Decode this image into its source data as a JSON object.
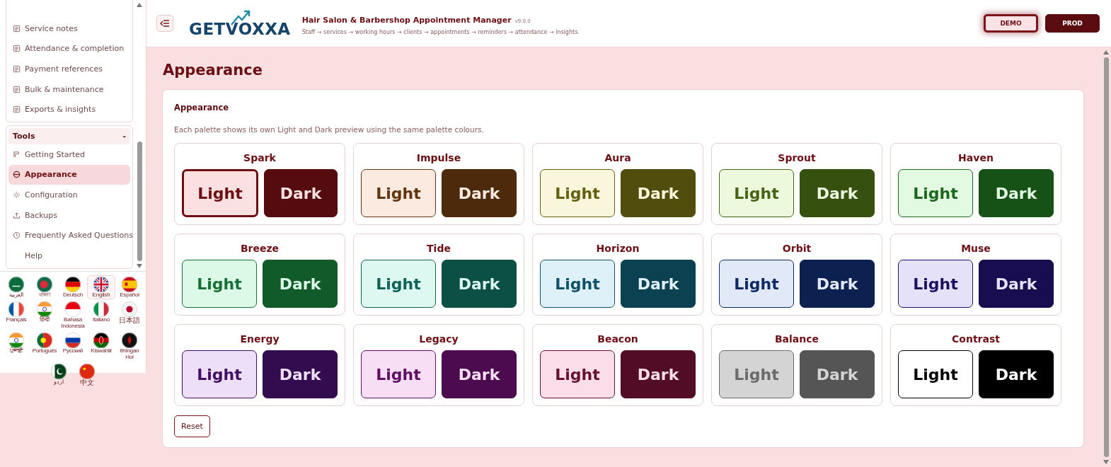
{
  "sidebar": {
    "sections": [
      {
        "items": [
          {
            "label": "Service notes",
            "selected": false
          },
          {
            "label": "Attendance & completion",
            "selected": false
          },
          {
            "label": "Payment references",
            "selected": false
          },
          {
            "label": "Bulk & maintenance",
            "selected": false
          },
          {
            "label": "Exports & insights",
            "selected": false
          }
        ]
      },
      {
        "title": "Tools",
        "toggle": "-",
        "expanded": true,
        "items": [
          {
            "label": "Getting Started",
            "selected": false
          },
          {
            "label": "Appearance",
            "selected": true
          },
          {
            "label": "Configuration",
            "selected": false
          },
          {
            "label": "Backups",
            "selected": false
          },
          {
            "label": "Frequently Asked Questions",
            "selected": false
          },
          {
            "label": "Help",
            "selected": false
          }
        ]
      }
    ],
    "languages": [
      {
        "label": "العربية",
        "selected": false
      },
      {
        "label": "বাংলা",
        "selected": false
      },
      {
        "label": "Deutsch",
        "selected": false
      },
      {
        "label": "English",
        "selected": true
      },
      {
        "label": "Español",
        "selected": false
      },
      {
        "label": "Français",
        "selected": false
      },
      {
        "label": "हिन्दी",
        "selected": false
      },
      {
        "label": "Bahasa Indonesia",
        "selected": false
      },
      {
        "label": "Italiano",
        "selected": false
      },
      {
        "label": "日本語",
        "selected": false
      },
      {
        "label": "ਪੰਜਾਬੀ",
        "selected": false
      },
      {
        "label": "Português",
        "selected": false
      },
      {
        "label": "Русский",
        "selected": false
      },
      {
        "label": "Kiswahili",
        "selected": false
      },
      {
        "label": "tlhIngan Hol",
        "selected": false
      },
      {
        "label": "اردو",
        "selected": false
      },
      {
        "label": "中文",
        "selected": false
      }
    ]
  },
  "header": {
    "logo": "GETVOXXA",
    "title": "Hair Salon & Barbershop Appointment Manager",
    "version": "v9.0.0",
    "subtitle": "Staff → services → working hours → clients → appointments → reminders → attendance → insights.",
    "modes": [
      {
        "label": "DEMO",
        "selected": true
      },
      {
        "label": "PROD",
        "selected": false
      }
    ]
  },
  "page": {
    "title": "Appearance",
    "card_title": "Appearance",
    "description": "Each palette shows its own Light and Dark preview using the same palette colours.",
    "palettes": [
      {
        "name": "Spark",
        "selected": true,
        "previews": [
          {
            "label": "Light",
            "color": "#fbe0e2"
          },
          {
            "label": "Dark",
            "color": "#560b0e"
          }
        ]
      },
      {
        "name": "Impulse",
        "selected": false,
        "previews": [
          {
            "label": "Light",
            "color": "#fbeadf"
          },
          {
            "label": "Dark",
            "color": "#4e2a0d"
          }
        ]
      },
      {
        "name": "Aura",
        "selected": false,
        "previews": [
          {
            "label": "Light",
            "color": "#faf6dc"
          },
          {
            "label": "Dark",
            "color": "#514d0d"
          }
        ]
      },
      {
        "name": "Sprout",
        "selected": false,
        "previews": [
          {
            "label": "Light",
            "color": "#ecf9dd"
          },
          {
            "label": "Dark",
            "color": "#36500f"
          }
        ]
      },
      {
        "name": "Haven",
        "selected": false,
        "previews": [
          {
            "label": "Light",
            "color": "#e2f9e2"
          },
          {
            "label": "Dark",
            "color": "#165216"
          }
        ]
      },
      {
        "name": "Breeze",
        "selected": false,
        "previews": [
          {
            "label": "Light",
            "color": "#dcf8e6"
          },
          {
            "label": "Dark",
            "color": "#115a2a"
          }
        ]
      },
      {
        "name": "Tide",
        "selected": false,
        "previews": [
          {
            "label": "Light",
            "color": "#dcf8f1"
          },
          {
            "label": "Dark",
            "color": "#0c4f44"
          }
        ]
      },
      {
        "name": "Horizon",
        "selected": false,
        "previews": [
          {
            "label": "Light",
            "color": "#dff1f8"
          },
          {
            "label": "Dark",
            "color": "#0c4152"
          }
        ]
      },
      {
        "name": "Orbit",
        "selected": false,
        "previews": [
          {
            "label": "Light",
            "color": "#e1e8f8"
          },
          {
            "label": "Dark",
            "color": "#0c2150"
          }
        ]
      },
      {
        "name": "Muse",
        "selected": false,
        "previews": [
          {
            "label": "Light",
            "color": "#e5e1f8"
          },
          {
            "label": "Dark",
            "color": "#170d4f"
          }
        ]
      },
      {
        "name": "Energy",
        "selected": false,
        "previews": [
          {
            "label": "Light",
            "color": "#eddff8"
          },
          {
            "label": "Dark",
            "color": "#330c50"
          }
        ]
      },
      {
        "name": "Legacy",
        "selected": false,
        "previews": [
          {
            "label": "Light",
            "color": "#f7def5"
          },
          {
            "label": "Dark",
            "color": "#4d0b4f"
          }
        ]
      },
      {
        "name": "Beacon",
        "selected": false,
        "previews": [
          {
            "label": "Light",
            "color": "#fadde8"
          },
          {
            "label": "Dark",
            "color": "#520c25"
          }
        ]
      },
      {
        "name": "Balance",
        "selected": false,
        "previews": [
          {
            "label": "Light",
            "color": "#d4d4d4"
          },
          {
            "label": "Dark",
            "color": "#555555"
          }
        ]
      },
      {
        "name": "Contrast",
        "selected": false,
        "previews": [
          {
            "label": "Light",
            "color": "#ffffff"
          },
          {
            "label": "Dark",
            "color": "#000000"
          }
        ]
      }
    ],
    "reset": "Reset"
  }
}
